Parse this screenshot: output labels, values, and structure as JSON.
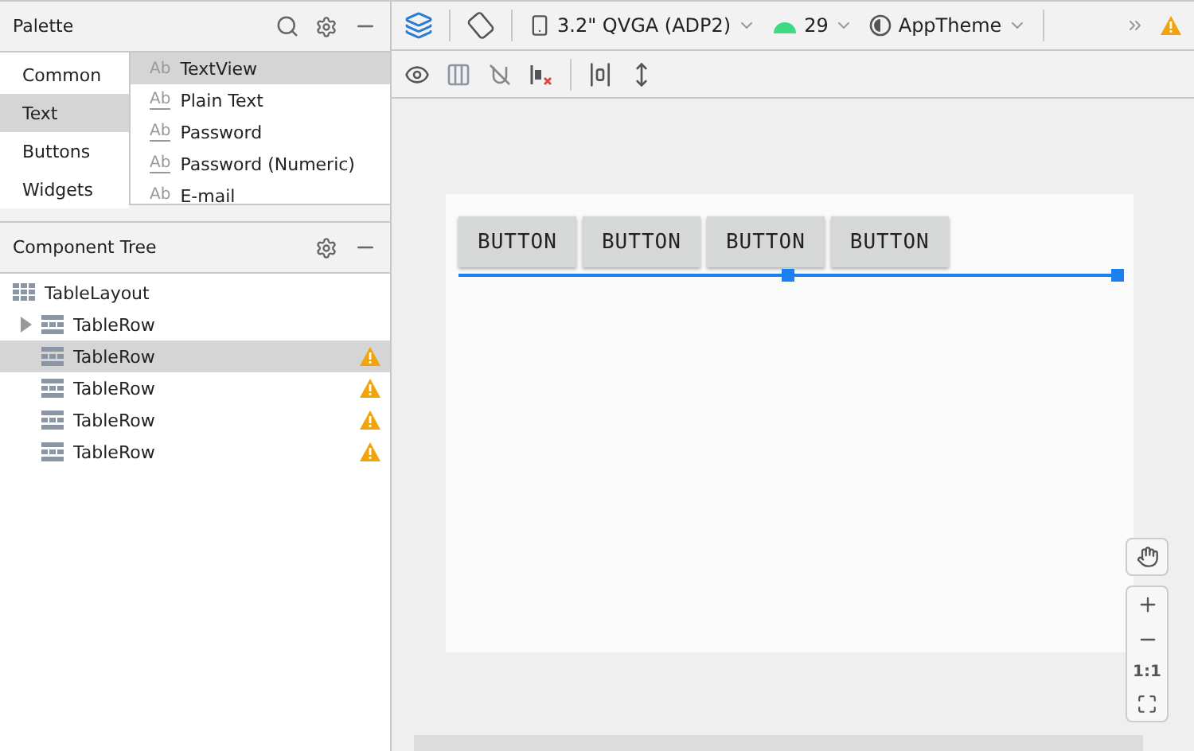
{
  "palette": {
    "title": "Palette",
    "categories": [
      {
        "label": "Common",
        "selected": false
      },
      {
        "label": "Text",
        "selected": true
      },
      {
        "label": "Buttons",
        "selected": false
      },
      {
        "label": "Widgets",
        "selected": false
      }
    ],
    "items": [
      {
        "icon_text": "Ab",
        "label": "TextView",
        "selected": true,
        "kind": "text"
      },
      {
        "icon_text": "Ab",
        "label": "Plain Text",
        "selected": false,
        "kind": "field"
      },
      {
        "icon_text": "Ab",
        "label": "Password",
        "selected": false,
        "kind": "field"
      },
      {
        "icon_text": "Ab",
        "label": "Password (Numeric)",
        "selected": false,
        "kind": "field"
      },
      {
        "icon_text": "Ab",
        "label": "E-mail",
        "selected": false,
        "kind": "field"
      }
    ]
  },
  "component_tree": {
    "title": "Component Tree",
    "root": {
      "label": "TableLayout",
      "children": [
        {
          "label": "TableRow",
          "expanded": false,
          "selected": false,
          "warning": false
        },
        {
          "label": "TableRow",
          "selected": true,
          "warning": true
        },
        {
          "label": "TableRow",
          "selected": false,
          "warning": true
        },
        {
          "label": "TableRow",
          "selected": false,
          "warning": true
        },
        {
          "label": "TableRow",
          "selected": false,
          "warning": true
        }
      ]
    }
  },
  "toolbar": {
    "device": "3.2\" QVGA (ADP2)",
    "api_level": "29",
    "theme": "AppTheme"
  },
  "canvas": {
    "buttons": [
      "BUTTON",
      "BUTTON",
      "BUTTON",
      "BUTTON"
    ]
  },
  "zoom_controls": {
    "actual_size": "1:1"
  }
}
